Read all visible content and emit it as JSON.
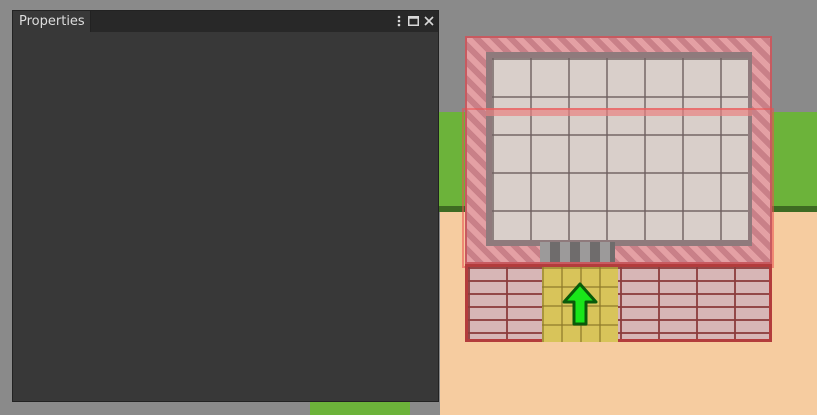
{
  "panel": {
    "tab_title": "Properties",
    "buttons": {
      "menu": "kebab-icon",
      "maximize": "maximize-icon",
      "close": "close-icon"
    }
  },
  "scene": {
    "colors": {
      "background": "#8a8a8a",
      "grass": "#6cb33a",
      "sand": "#f6cca0",
      "selection": "#e05050",
      "door": "#d8c45a",
      "arrow": "#19e619"
    },
    "arrow_icon": "arrow-up-icon"
  }
}
